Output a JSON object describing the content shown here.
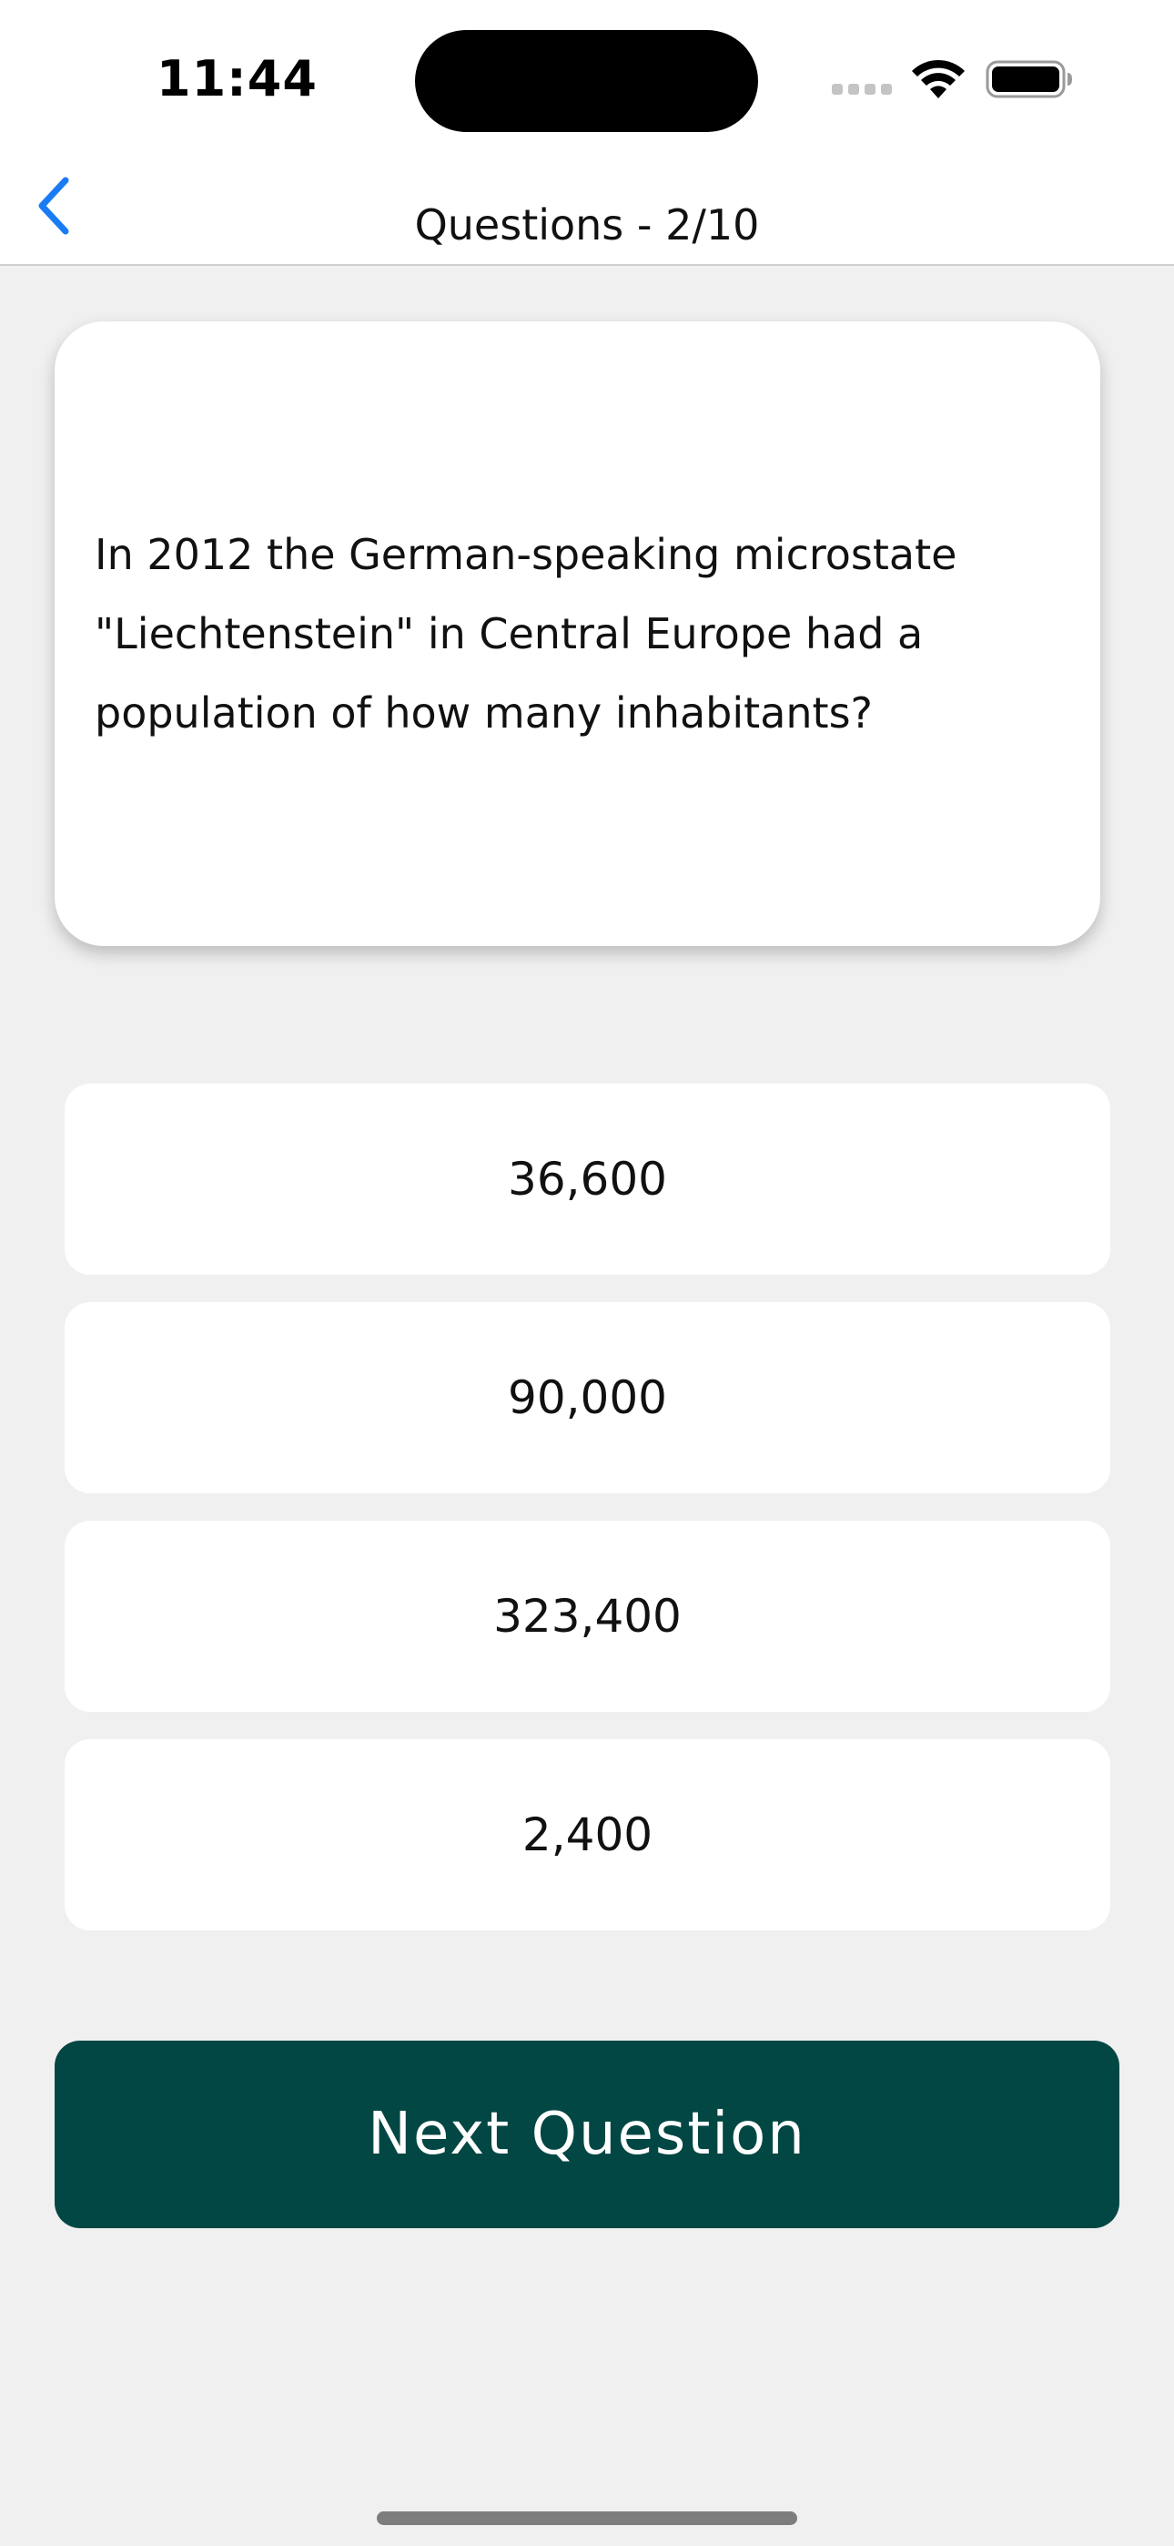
{
  "status_bar": {
    "time": "11:44"
  },
  "nav": {
    "title": "Questions - 2/10",
    "back_icon": "chevron-left-icon",
    "accent_color": "#1a7cf5"
  },
  "question": {
    "text": "In 2012 the German-speaking microstate \"Liechtenstein\" in Central Europe had a population of how many inhabitants?"
  },
  "answers": [
    {
      "label": "36,600"
    },
    {
      "label": "90,000"
    },
    {
      "label": "323,400"
    },
    {
      "label": "2,400"
    }
  ],
  "next_button": {
    "label": "Next Question",
    "color": "#034744"
  }
}
